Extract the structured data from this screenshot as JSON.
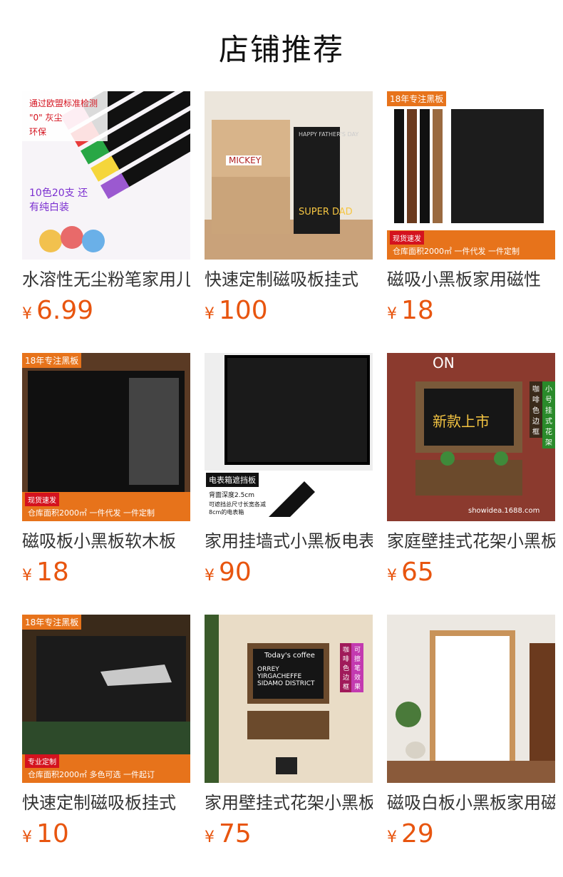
{
  "page": {
    "title": "店铺推荐"
  },
  "products": [
    {
      "name": "水溶性无尘粉笔家用儿童",
      "price": "6.99",
      "currency": "¥",
      "thumb": "chalk-markers",
      "badges": [
        "通过欧盟标准检测",
        "\"0\" 灰尘",
        "环保"
      ],
      "caption": "10色20支 还有纯白装"
    },
    {
      "name": "快速定制磁吸板挂式",
      "price": "100",
      "currency": "¥",
      "thumb": "room-board",
      "badges": [
        "MICKEY",
        "SUPER DAD"
      ],
      "caption": "HAPPY FATHER'S DAY"
    },
    {
      "name": "磁吸小黑板家用磁性",
      "price": "18",
      "currency": "¥",
      "thumb": "magnet-board",
      "badges": [
        "18年专注黑板",
        "现货速发"
      ],
      "caption": "仓库面积2000㎡ 一件代发 一件定制"
    },
    {
      "name": "磁吸板小黑板软木板",
      "price": "18",
      "currency": "¥",
      "thumb": "cork-board",
      "badges": [
        "18年专注黑板",
        "现货速发"
      ],
      "caption": "仓库面积2000㎡ 一件代发 一件定制"
    },
    {
      "name": "家用挂墙式小黑板电表",
      "price": "90",
      "currency": "¥",
      "thumb": "meter-board",
      "badges": [
        "电表箱遮挡板",
        "背面深度2.5cm",
        "可遮挡总尺寸长宽各减8cm的电表箱"
      ],
      "caption": ""
    },
    {
      "name": "家庭壁挂式花架小黑板",
      "price": "65",
      "currency": "¥",
      "thumb": "flower-shelf",
      "badges": [
        "ON",
        "新款上市",
        "咖啡色边框",
        "小号挂式花架"
      ],
      "caption": "showidea.1688.com"
    },
    {
      "name": "快速定制磁吸板挂式",
      "price": "10",
      "currency": "¥",
      "thumb": "menu-board",
      "badges": [
        "18年专注黑板",
        "专业定制"
      ],
      "caption": "仓库面积2000㎡ 多色可选 一件起订"
    },
    {
      "name": "家用壁挂式花架小黑板",
      "price": "75",
      "currency": "¥",
      "thumb": "coffee-board",
      "badges": [
        "Today's coffee",
        "咖啡色边框",
        "可擦笔效果"
      ],
      "caption": "ORREY YIRGACHEFFE SIDAMO DISTRICT"
    },
    {
      "name": "磁吸白板小黑板家用磁",
      "price": "29",
      "currency": "¥",
      "thumb": "white-board",
      "badges": [],
      "caption": ""
    }
  ],
  "colors": {
    "price": "#e8550f",
    "accent": "#f2a81d",
    "text": "#333333"
  }
}
